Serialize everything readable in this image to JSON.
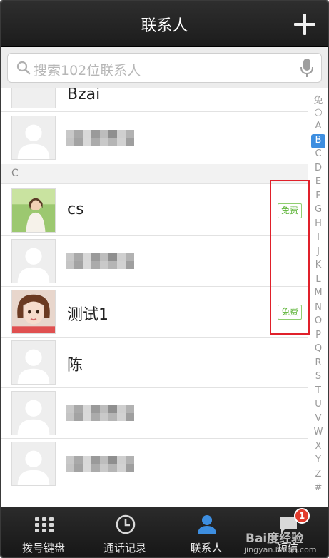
{
  "header": {
    "title": "联系人"
  },
  "search": {
    "placeholder": "搜索102位联系人"
  },
  "contacts": {
    "partial_top_name": "Bzai",
    "section_c": "C",
    "rows": [
      {
        "name": "",
        "blurred": true,
        "photo": false,
        "free": false
      },
      {
        "name": "cs",
        "blurred": false,
        "photo": true,
        "photo_style": "girl-outdoor",
        "free": true,
        "free_label": "免费"
      },
      {
        "name": "",
        "blurred": true,
        "photo": false,
        "free": false
      },
      {
        "name": "测试1",
        "blurred": false,
        "photo": true,
        "photo_style": "girl-bob",
        "free": true,
        "free_label": "免费"
      },
      {
        "name": "陈",
        "blurred": false,
        "photo": false,
        "free": false
      },
      {
        "name": "",
        "blurred": true,
        "photo": false,
        "free": false
      },
      {
        "name": "",
        "blurred": true,
        "photo": false,
        "free": false
      }
    ]
  },
  "index_bar": {
    "letters": [
      "免",
      "○",
      "A",
      "B",
      "C",
      "D",
      "E",
      "F",
      "G",
      "H",
      "I",
      "J",
      "K",
      "L",
      "M",
      "N",
      "O",
      "P",
      "Q",
      "R",
      "S",
      "T",
      "U",
      "V",
      "W",
      "X",
      "Y",
      "Z",
      "#"
    ],
    "active": "B"
  },
  "tabs": [
    {
      "label": "拨号键盘",
      "icon": "dialpad-icon"
    },
    {
      "label": "通话记录",
      "icon": "clock-icon"
    },
    {
      "label": "联系人",
      "icon": "person-icon",
      "active": true
    },
    {
      "label": "短信",
      "icon": "message-icon"
    }
  ],
  "notification_badge": "1",
  "watermark": {
    "logo": "Bai度经验",
    "text": "jingyan.baidu.com"
  },
  "colors": {
    "accent": "#3d8ee0",
    "highlight_box": "#e0202a",
    "free_badge": "#5fb53a",
    "badge": "#e23b2c"
  }
}
